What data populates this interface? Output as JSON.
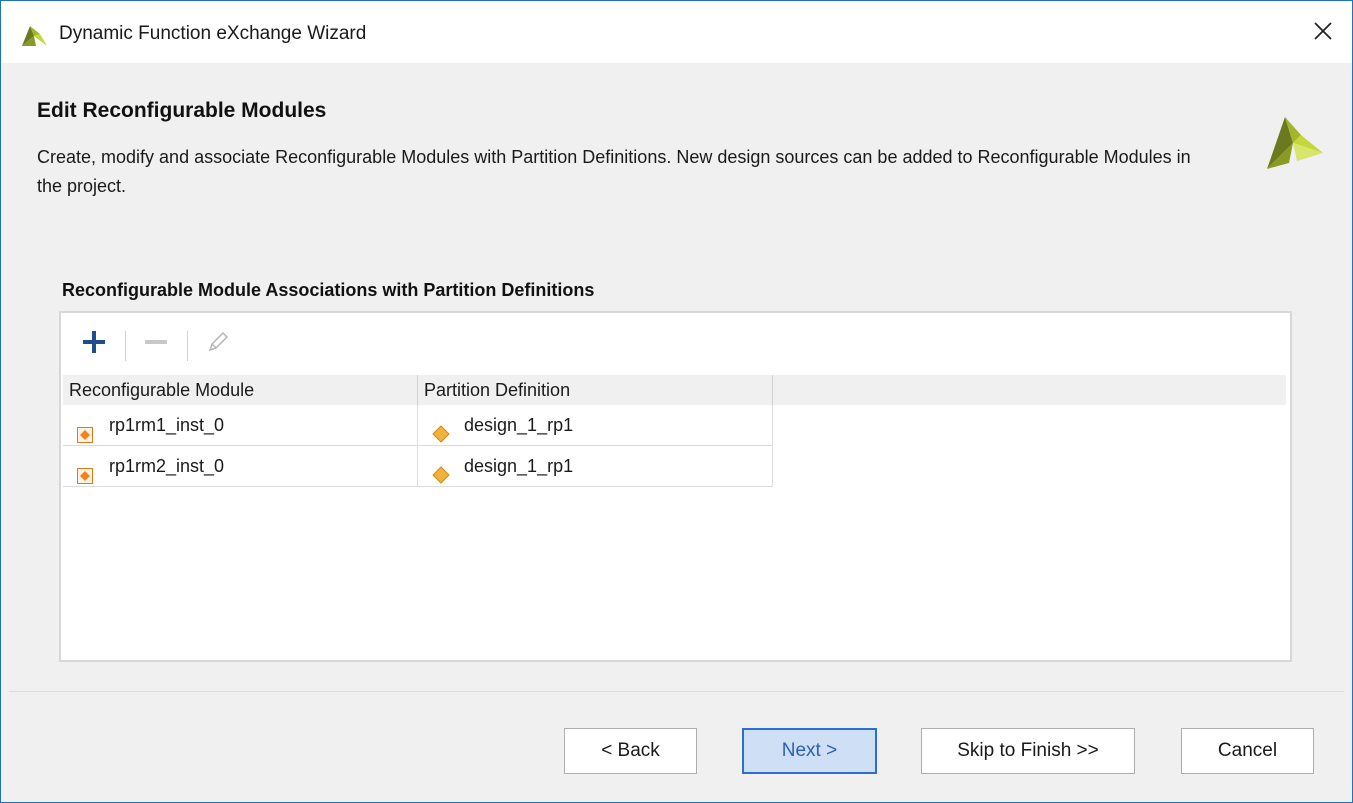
{
  "window": {
    "title": "Dynamic Function eXchange Wizard",
    "close_glyph": "✕"
  },
  "header": {
    "title": "Edit Reconfigurable Modules",
    "description": "Create, modify and associate Reconfigurable Modules with Partition Definitions. New design sources can be added to Reconfigurable Modules in the project."
  },
  "section": {
    "title": "Reconfigurable Module Associations with Partition Definitions"
  },
  "toolbar": {
    "add_icon": "plus-icon",
    "remove_icon": "minus-icon",
    "edit_icon": "pencil-icon"
  },
  "table": {
    "columns": [
      "Reconfigurable Module",
      "Partition Definition"
    ],
    "rows": [
      {
        "module": "rp1rm1_inst_0",
        "partition": "design_1_rp1"
      },
      {
        "module": "rp1rm2_inst_0",
        "partition": "design_1_rp1"
      }
    ]
  },
  "footer": {
    "back_label": "< Back",
    "next_label": "Next >",
    "skip_label": "Skip to Finish >>",
    "cancel_label": "Cancel"
  },
  "colors": {
    "accent": "#2b6fd0",
    "logo_dark": "#6b7a1f",
    "logo_light": "#c4d83a",
    "module_icon": "#f58220",
    "partition_icon": "#f0b23c"
  }
}
